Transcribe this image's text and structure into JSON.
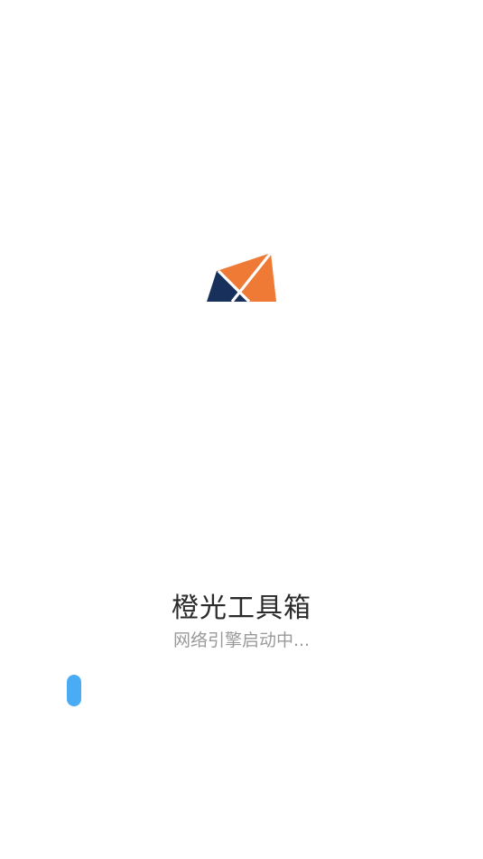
{
  "app": {
    "title": "橙光工具箱",
    "status": "网络引擎启动中..."
  },
  "logo": {
    "icon": "orange-navy-x-logo",
    "colors": {
      "orange": "#ee7a36",
      "navy": "#17305c"
    }
  },
  "progress": {
    "value": 0.04,
    "color": "#4aacf5"
  }
}
